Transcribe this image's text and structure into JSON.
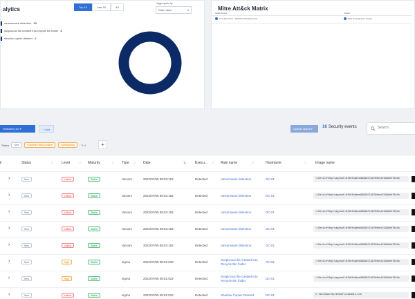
{
  "analytics": {
    "title": "alytics",
    "tabs": [
      {
        "label": "Top 10",
        "active": true
      },
      {
        "label": "Last 10",
        "active": false
      },
      {
        "label": "All",
        "active": false
      }
    ],
    "aggregate_label": "Aggregate by",
    "aggregate_value": "Rule name",
    "legend": [
      {
        "label": "ransomware detection",
        "count": "10"
      },
      {
        "label": "suspicious file created into recycle bin folder",
        "count": "4"
      },
      {
        "label": "shadow copies deleted",
        "count": "2"
      }
    ],
    "donut_color": "#0c2a66"
  },
  "mitre": {
    "title": "Mitre Att&ck Matrix",
    "col1_header": "Initial Access",
    "col2_header": "Impact",
    "col1_cell": "User Execution · Malicious File Execution",
    "col2_cell": "Data Encrypted for Impact"
  },
  "toolbar": {
    "selected_label": "Selected (10) ▾",
    "add_label": "+ Add",
    "update_label": "Update status ▾",
    "events_count": "16",
    "events_label": "Security events",
    "search_placeholder": "Search"
  },
  "filters": {
    "label": "Status",
    "chips": [
      "New",
      "Untreated false positive",
      "Investigating"
    ],
    "edit_label": "✎ 0"
  },
  "table": {
    "columns": [
      "Status",
      "Level",
      "Maturity",
      "Type",
      "Date",
      "Execu...",
      "Rule name",
      "Hostname",
      "Image name"
    ],
    "rows": [
      {
        "status": "New",
        "level": "critical",
        "maturity": "Stable",
        "type": "ransom",
        "date": "2022/07/05 08:53:152",
        "exec": "Detected",
        "rule": "ransomware detection",
        "host": "DC-01",
        "image": "\\\\Device\\Mup\\vagrant\\6fd6fa9eee9999671497b0ee1229d9e07841b"
      },
      {
        "status": "New",
        "level": "critical",
        "maturity": "Stable",
        "type": "ransom",
        "date": "2022/07/05 08:53:152",
        "exec": "Detected",
        "rule": "ransomware detection",
        "host": "DC-01",
        "image": "\\\\Device\\Mup\\vagrant\\6fd6fa9eee9999671497b0ee1229d9e07841b"
      },
      {
        "status": "New",
        "level": "critical",
        "maturity": "Stable",
        "type": "ransom",
        "date": "2022/07/05 08:53:152",
        "exec": "Detected",
        "rule": "ransomware detection",
        "host": "DC-01",
        "image": "\\\\Device\\Mup\\vagrant\\6fd6fa9eee9999671497b0ee1229d9e07841b"
      },
      {
        "status": "New",
        "level": "critical",
        "maturity": "Stable",
        "type": "ransom",
        "date": "2022/07/05 08:53:152",
        "exec": "Detected",
        "rule": "ransomware detection",
        "host": "DC-01",
        "image": "\\\\Device\\Mup\\vagrant\\6fd6fa9eee9999671497b0ee1229d9e07841b"
      },
      {
        "status": "New",
        "level": "critical",
        "maturity": "Stable",
        "type": "ransom",
        "date": "2022/07/05 08:53:152",
        "exec": "Detected",
        "rule": "ransomware detection",
        "host": "DC-01",
        "image": "\\\\Device\\Mup\\vagrant\\6fd6fa9eee9999671497b0ee1229d9e07841b"
      },
      {
        "status": "New",
        "level": "high",
        "maturity": "Stable",
        "type": "sigma",
        "date": "2022/07/05 08:51:522",
        "exec": "Detected",
        "rule": "Suspicious file created into Recycle Bin folder",
        "host": "DC-01",
        "image": "\\\\Device\\Mup\\vagrant\\6fd6fa9eee9999671497b0ee1229d9e07841b"
      },
      {
        "status": "New",
        "level": "high",
        "maturity": "Stable",
        "type": "sigma",
        "date": "2022/07/05 08:51:522",
        "exec": "Detected",
        "rule": "Suspicious file created into Recycle Bin folder",
        "host": "DC-01",
        "image": "\\\\Device\\Mup\\vagrant\\6fd6fa9eee9999671497b0ee1229d9e07841b"
      },
      {
        "status": "New",
        "level": "critical",
        "maturity": "Stable",
        "type": "sigma",
        "date": "2022/07/05 08:51:522",
        "exec": "Detected",
        "rule": "Shadow Copies Deleted",
        "host": "DC-01",
        "image": "C:\\Windows\\System32\\vssadmin.exe"
      }
    ]
  }
}
